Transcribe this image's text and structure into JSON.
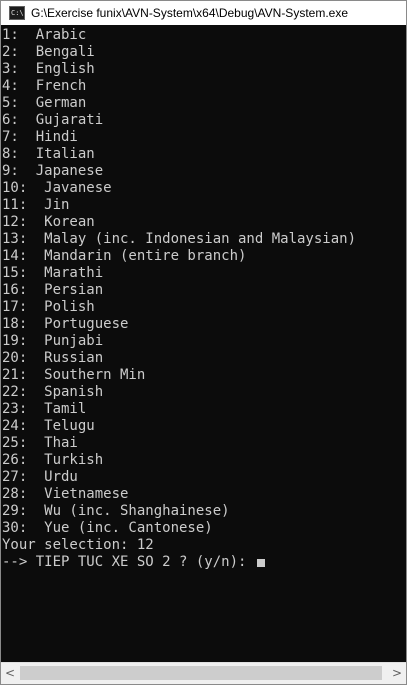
{
  "window": {
    "title": "G:\\Exercise funix\\AVN-System\\x64\\Debug\\AVN-System.exe",
    "icon": "console-app-icon",
    "icon_label": "C:\\"
  },
  "console": {
    "lines": [
      "1:  Arabic",
      "2:  Bengali",
      "3:  English",
      "4:  French",
      "5:  German",
      "6:  Gujarati",
      "7:  Hindi",
      "8:  Italian",
      "9:  Japanese",
      "10:  Javanese",
      "11:  Jin",
      "12:  Korean",
      "13:  Malay (inc. Indonesian and Malaysian)",
      "14:  Mandarin (entire branch)",
      "15:  Marathi",
      "16:  Persian",
      "17:  Polish",
      "18:  Portuguese",
      "19:  Punjabi",
      "20:  Russian",
      "21:  Southern Min",
      "22:  Spanish",
      "23:  Tamil",
      "24:  Telugu",
      "25:  Thai",
      "26:  Turkish",
      "27:  Urdu",
      "28:  Vietnamese",
      "29:  Wu (inc. Shanghainese)",
      "30:  Yue (inc. Cantonese)",
      "Your selection: 12"
    ],
    "prompt": "--> TIEP TUC XE SO 2 ? (y/n): ",
    "text_color": "#cccccc",
    "background_color": "#0c0c0c"
  },
  "scrollbar": {
    "left_arrow": "<",
    "right_arrow": ">"
  }
}
